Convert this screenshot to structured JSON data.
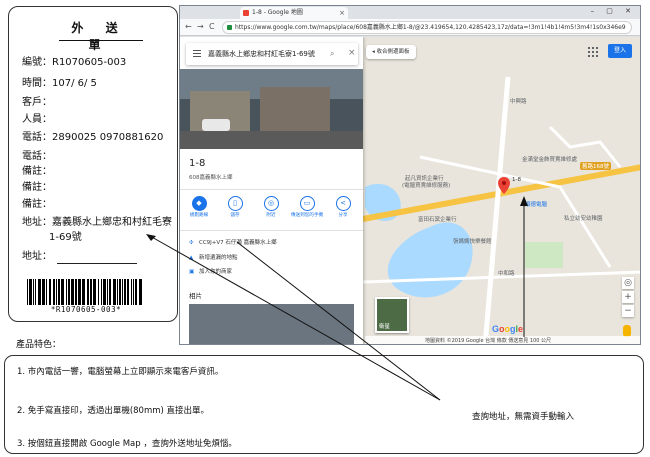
{
  "receipt": {
    "title": "外 送 單",
    "fields": [
      {
        "label": "編號：",
        "value": "R1070605-003"
      },
      {
        "label": "時間：",
        "value": "107/  6/  5"
      },
      {
        "label": "客戶：",
        "value": ""
      },
      {
        "label": "人員：",
        "value": ""
      },
      {
        "label": "電話：",
        "value": "2890025        0970881620"
      },
      {
        "label": "電話：",
        "value": ""
      },
      {
        "label": "備註：",
        "value": ""
      },
      {
        "label": "備註：",
        "value": ""
      },
      {
        "label": "備註：",
        "value": ""
      },
      {
        "label": "地址：",
        "value": "嘉義縣水上鄉忠和村紅毛寮"
      },
      {
        "label": "",
        "value": "1-69號"
      },
      {
        "label": "地址：",
        "value": ""
      }
    ],
    "barcode_text": "*R1070605-003*"
  },
  "browser": {
    "tab_title": "1-8 - Google 地圖",
    "url": "https://www.google.com.tw/maps/place/608嘉義縣水上鄉1-8/@23.419654,120.4285423,17z/data=!3m1!4b1!4m5!3m4!1s0x346e9",
    "back": "←",
    "forward": "→",
    "reload": "C",
    "window_controls": "– ▢ ✕"
  },
  "maps_panel": {
    "search_value": "嘉義縣水上鄉忠和村紅毛寮1-69號",
    "place_title": "1-8",
    "place_subtitle": "608嘉義縣水上鄉",
    "actions": [
      {
        "icon": "directions-icon",
        "glyph": "◆",
        "label": "規劃路線"
      },
      {
        "icon": "save-icon",
        "glyph": "▯",
        "label": "儲存"
      },
      {
        "icon": "nearby-icon",
        "glyph": "◎",
        "label": "附近"
      },
      {
        "icon": "send-to-phone-icon",
        "glyph": "▭",
        "label": "傳送到您的手機"
      },
      {
        "icon": "share-icon",
        "glyph": "<",
        "label": "分享"
      }
    ],
    "info_rows": [
      {
        "icon": "plus-code-icon",
        "glyph": "✣",
        "text": "CC9J+V7 石仔瀨 嘉義縣水上鄉"
      },
      {
        "icon": "missing-place-icon",
        "glyph": "▲",
        "text": "新增遺漏的地點"
      },
      {
        "icon": "add-business-icon",
        "glyph": "▣",
        "text": "加入你的商家"
      }
    ],
    "photos_heading": "相片"
  },
  "map": {
    "toggle_panel": "◂ 收合側邊面板",
    "signin": "登入",
    "road_label": "舊路168號",
    "labels": [
      {
        "text": "1-8",
        "cls": "dark"
      },
      {
        "text": "起凡資訊企業行",
        "cls": ""
      },
      {
        "text": "(電腦買賣維修服務)",
        "cls": ""
      },
      {
        "text": "金滿堂金飾買賣維修處",
        "cls": ""
      },
      {
        "text": "順德電腦",
        "cls": "poi"
      },
      {
        "text": "富田石窯企業行",
        "cls": ""
      },
      {
        "text": "私立幼安幼稚園",
        "cls": ""
      },
      {
        "text": "張媽媽快樂餐館",
        "cls": ""
      },
      {
        "text": "中興路",
        "cls": ""
      },
      {
        "text": "中和路",
        "cls": ""
      }
    ],
    "satellite_label": "衛星",
    "google_logo": "Google",
    "footer": "地圖資料 ©2019 Google    台灣    條款    傳送意見    100 公尺",
    "zoom_in": "+",
    "zoom_out": "−",
    "locate": "◎"
  },
  "features": {
    "heading": "產品特色：",
    "items": [
      "1. 市內電話一響，電腦螢幕上立即顯示來電客戶資訊。",
      "2. 免手寫直接印，透過出單機(80mm) 直接出單。",
      "3. 按個鈕直接開啟 Google Map ，查詢外送地址免煩惱。"
    ],
    "callout": "查詢地址，無需資手動輸入"
  },
  "colors": {
    "accent": "#1a73e8",
    "road": "#f6c343",
    "water": "#aadaff",
    "pin": "#ea4335"
  }
}
